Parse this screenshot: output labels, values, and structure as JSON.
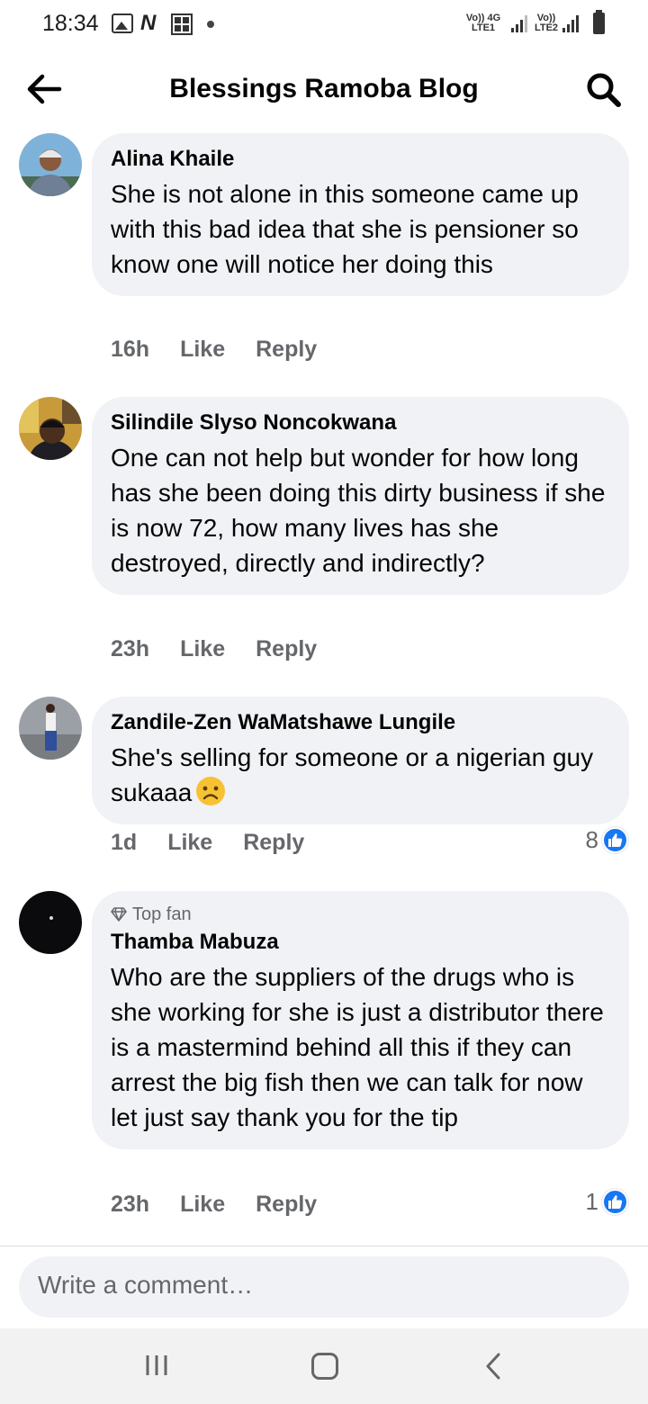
{
  "status_bar": {
    "time": "18:34",
    "sim1_label_top": "Vo)) 4G",
    "sim1_label_bottom": "LTE1",
    "sim2_label_top": "Vo))",
    "sim2_label_bottom": "LTE2"
  },
  "header": {
    "title": "Blessings Ramoba Blog",
    "back_icon": "arrow-left-icon",
    "search_icon": "search-icon"
  },
  "comments": [
    {
      "author": "Alina Khaile",
      "text": "She is not alone in this someone came up with this bad idea that she is pensioner so know one will notice her doing this",
      "time": "16h",
      "like_label": "Like",
      "reply_label": "Reply"
    },
    {
      "author": "Silindile Slyso Noncokwana",
      "text": "One can not help but wonder for how long has she been doing this dirty business if she is now 72, how many lives has she destroyed, directly and indirectly?",
      "time": "23h",
      "like_label": "Like",
      "reply_label": "Reply"
    },
    {
      "author": "Zandile-Zen WaMatshawe Lungile",
      "text": "She's selling for someone or a nigerian guy sukaaa",
      "time": "1d",
      "like_label": "Like",
      "reply_label": "Reply",
      "reaction_count": "8"
    },
    {
      "badge": "Top fan",
      "author": "Thamba Mabuza",
      "text": "Who are the suppliers of the drugs who is she working for she is just a distributor there is a mastermind behind all this if they can arrest the big fish then we can talk for now let just say thank you for the tip",
      "time": "23h",
      "like_label": "Like",
      "reply_label": "Reply",
      "reaction_count": "1"
    }
  ],
  "composer": {
    "placeholder": "Write a comment…"
  },
  "colors": {
    "bubble": "#f0f2f5",
    "secondary_text": "#65676b",
    "like_blue": "#1877f2"
  }
}
